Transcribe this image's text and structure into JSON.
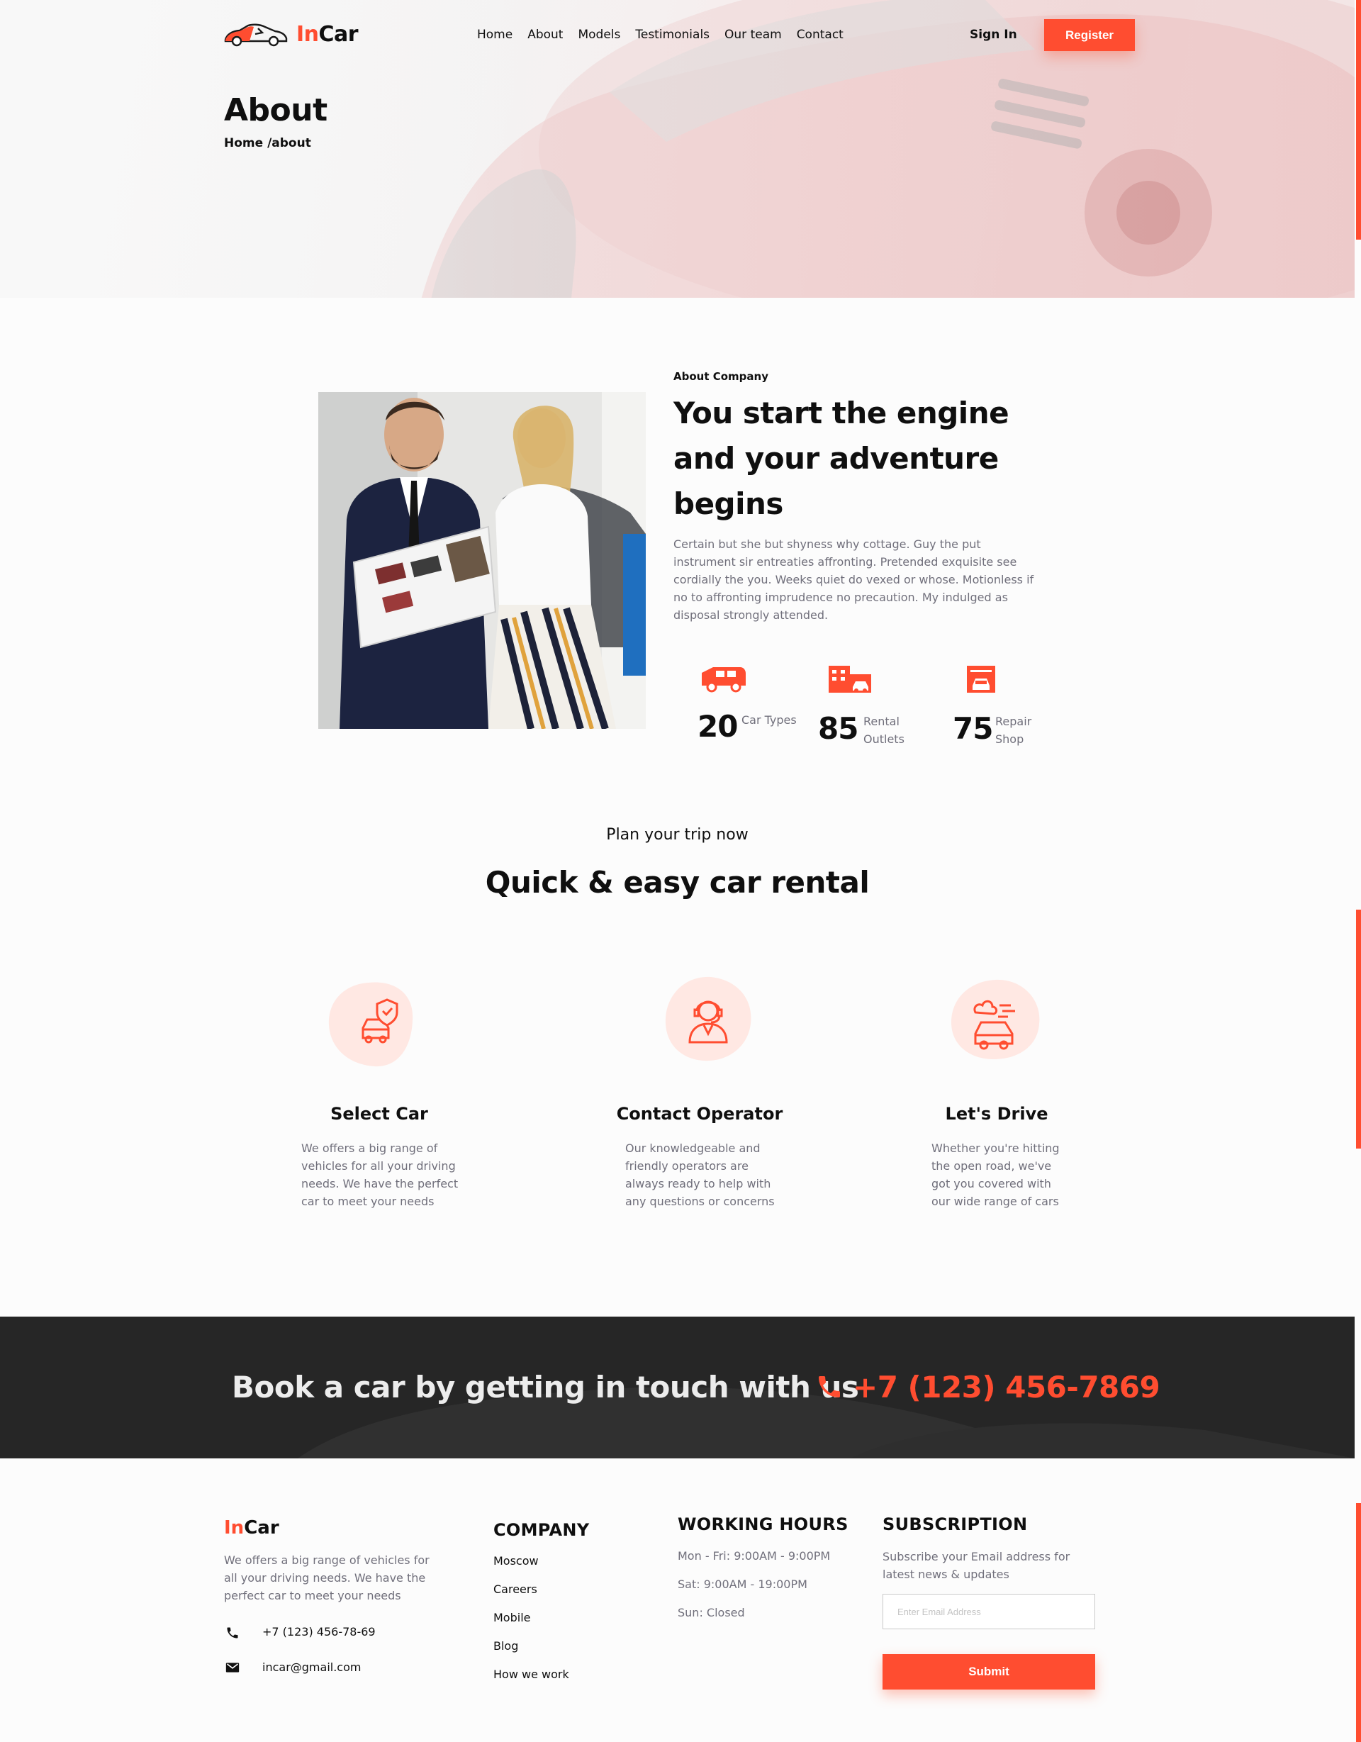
{
  "brand": {
    "prefix": "In",
    "suffix": "Car",
    "accent_color": "#ff4d30"
  },
  "nav": {
    "items": [
      {
        "label": "Home"
      },
      {
        "label": "About"
      },
      {
        "label": "Models"
      },
      {
        "label": "Testimonials"
      },
      {
        "label": "Our team"
      },
      {
        "label": "Contact"
      }
    ],
    "sign_in": "Sign In",
    "register": "Register"
  },
  "hero": {
    "title": "About",
    "breadcrumb": "Home /about"
  },
  "about": {
    "label": "About Company",
    "heading": "You start the engine and your adventure begins",
    "text": "Certain but she but shyness why cottage. Guy the put instrument sir entreaties affronting. Pretended exquisite see cordially the you. Weeks quiet do vexed or whose. Motionless if no to affronting imprudence no precaution. My indulged as disposal strongly attended.",
    "stats": [
      {
        "number": "20",
        "label": "Car Types",
        "icon": "van-icon"
      },
      {
        "number": "85",
        "label": "Rental Outlets",
        "icon": "building-icon"
      },
      {
        "number": "75",
        "label": "Repair Shop",
        "icon": "garage-icon"
      }
    ]
  },
  "steps": {
    "subtitle": "Plan your trip now",
    "title": "Quick & easy car rental",
    "items": [
      {
        "title": "Select Car",
        "text": "We offers a big range of vehicles for all your driving needs. We have the perfect car to meet your needs",
        "icon": "car-shield-icon"
      },
      {
        "title": "Contact Operator",
        "text": "Our knowledgeable and friendly operators are always ready to help with any questions or concerns",
        "icon": "operator-icon"
      },
      {
        "title": "Let's Drive",
        "text": "Whether you're hitting the open road, we've got you covered with our wide range of cars",
        "icon": "car-drive-icon"
      }
    ]
  },
  "banner": {
    "text": "Book a car by getting in touch with us",
    "phone": "+7 (123) 456-7869",
    "icon": "phone-icon"
  },
  "footer": {
    "about": "We offers a big range of vehicles for all your driving needs. We have the perfect car to meet your needs",
    "phone": "+7 (123) 456-78-69",
    "email": "incar@gmail.com",
    "company_heading": "COMPANY",
    "company_links": [
      "Moscow",
      "Careers",
      "Mobile",
      "Blog",
      "How we work"
    ],
    "hours_heading": "WORKING HOURS",
    "hours": [
      "Mon - Fri: 9:00AM - 9:00PM",
      "Sat: 9:00AM - 19:00PM",
      "Sun: Closed"
    ],
    "subscription_heading": "SUBSCRIPTION",
    "subscription_text": "Subscribe your Email address for latest news & updates",
    "email_placeholder": "Enter Email Address",
    "submit": "Submit"
  }
}
